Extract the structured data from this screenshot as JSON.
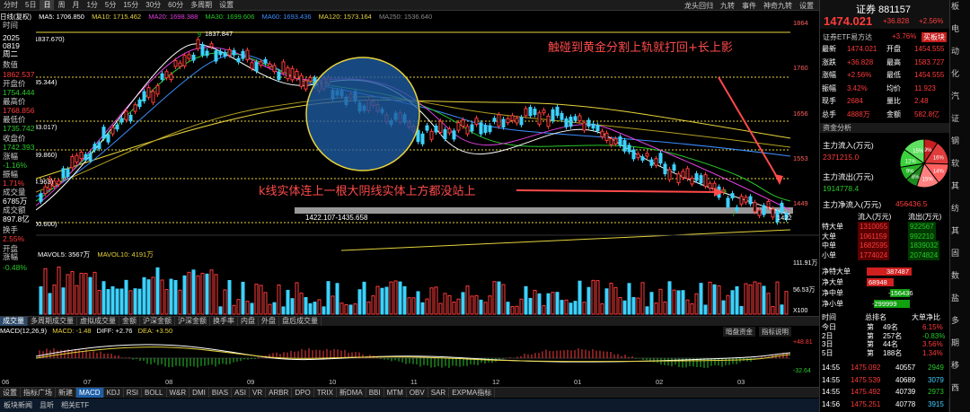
{
  "tabbar": {
    "items": [
      "分时",
      "5日",
      "日",
      "周",
      "月",
      "1分",
      "5分",
      "15分",
      "30分",
      "60分",
      "多周期",
      "设置"
    ],
    "active": 2
  },
  "topright": [
    "龙头回归",
    "九转",
    "事件",
    "神奇九转",
    "设置"
  ],
  "ma": {
    "label": "日线(复权)",
    "ma5": "MA5: 1706.850",
    "ma10": "MA10: 1715.462",
    "ma20": "MA20: 1698.388",
    "ma30": "MA30: 1699.606",
    "ma60": "MA60: 1693.436",
    "ma120": "MA120: 1573.164",
    "ma250": "MA250: 1536.640"
  },
  "left": {
    "time_label": "时间",
    "year": "2025",
    "date": "0819",
    "weekday": "周二",
    "val_label": "数值",
    "v1": "1862.537",
    "open_label": "开盘价",
    "open": "1754.444",
    "high_label": "最高价",
    "high": "1768.856",
    "low_label": "最低价",
    "low": "1735.742",
    "close_label": "收盘价",
    "close": "1742.393",
    "chg_label": "涨幅",
    "chg": "-1.16%",
    "amp_label": "振幅",
    "amp": "1.71%",
    "vol_label": "成交量",
    "vol": "6785万",
    "amt_label": "成交额",
    "amt": "897.8亿",
    "turn_label": "换手",
    "turn": "2.55%",
    "ochg_label": "开盘涨幅",
    "ochg": "-0.48%"
  },
  "chart_labels": {
    "high_mark": "1837.847",
    "left_1837": "1837.670)",
    "left_1835": "35.344)",
    "left_633": "33.017)",
    "left_9860": "39.860)",
    "left_963": "4.963)",
    "left_0500": "00.600)",
    "range_text": "1422.107-1435.658",
    "low_mark": "1422",
    "count_a": "9",
    "count_b": "9",
    "count_c": "7"
  },
  "price_axis": [
    "1864",
    "1760",
    "1656",
    "1553",
    "1449"
  ],
  "vol_axis": [
    "111.91万",
    "56.53万",
    "X100"
  ],
  "macd_axis": [
    "+48.81",
    "-32.64"
  ],
  "annotations": {
    "top": "触碰到黄金分割上轨就打回+长上影",
    "mid": "k线实体连上一根大阴线实体上方都没站上"
  },
  "volbar": {
    "mavol5": "MAVOL5: 3567万",
    "mavol10": "MAVOL10: 4191万"
  },
  "bottomtabs": [
    "成交量",
    "多周期成交量",
    "虚拟成交量",
    "金额",
    "沪深金额",
    "沪深金额",
    "换手率",
    "内盘",
    "外盘",
    "盘后成交量"
  ],
  "macd": {
    "label": "MACD(12,26,9)",
    "macd": "MACD: -1.48",
    "diff": "DIFF: +2.76",
    "dea": "DEA: +3.50",
    "btn1": "暗盘资金",
    "btn2": "指标说明"
  },
  "xaxis": [
    "06",
    "07",
    "08",
    "09",
    "10",
    "11",
    "12",
    "01",
    "02",
    "03",
    "04"
  ],
  "footbar": [
    "设置",
    "指标广场",
    "新建",
    "MACD",
    "KDJ",
    "RSI",
    "BOLL",
    "W&R",
    "DMI",
    "BIAS",
    "ASI",
    "VR",
    "ARBR",
    "DPO",
    "TRIX",
    "新DMA",
    "BBI",
    "MTM",
    "OBV",
    "SAR",
    "EXPMA指标"
  ],
  "footbar_active": 3,
  "statusbar": [
    "板块新闻",
    "且听",
    "相关ETF"
  ],
  "rp": {
    "title": "证券 881157",
    "price": "1474.021",
    "change": "+36.828",
    "pct": "+2.56%",
    "sub1": "证券ETF易方达",
    "sub2": "+3.76%",
    "sub3": "买板块",
    "rows": [
      [
        "最新",
        "1474.021",
        "开盘",
        "1454.555"
      ],
      [
        "涨跌",
        "+36.828",
        "最高",
        "1583.727"
      ],
      [
        "涨幅",
        "+2.56%",
        "最低",
        "1454.555"
      ],
      [
        "振幅",
        "3.42%",
        "均价",
        "11.923"
      ],
      [
        "现手",
        "2684",
        "量比",
        "2.48"
      ],
      [
        "总手",
        "4888万",
        "金额",
        "582.8亿"
      ]
    ],
    "sec1": "资金分析",
    "inflow_label": "主力流入(万元)",
    "inflow": "2371215.0",
    "outflow_label": "主力流出(万元)",
    "outflow": "1914778.4",
    "net_label": "主力净流入(万元)",
    "net": "456436.5",
    "pie": [
      "9%",
      "16%",
      "14%",
      "15%",
      "8%",
      "9%",
      "12%",
      "15%"
    ],
    "flow_head": [
      "",
      "流入(万元)",
      "流出(万元)"
    ],
    "flows": [
      [
        "特大单",
        "1310055",
        "922567"
      ],
      [
        "大单",
        "1061159",
        "992210"
      ],
      [
        "中单",
        "1682595",
        "1839032"
      ],
      [
        "小单",
        "1774024",
        "2074824"
      ]
    ],
    "nets": [
      [
        "净特大单",
        "387487"
      ],
      [
        "净大单",
        "68948"
      ],
      [
        "净中单",
        "-156436"
      ],
      [
        "净小单",
        "-299999"
      ]
    ],
    "rank_head": [
      "时间",
      "总排名",
      "大单净比"
    ],
    "ranks": [
      [
        "今日",
        "第",
        "49名",
        "6.15%"
      ],
      [
        "2日",
        "第",
        "257名",
        "-0.83%"
      ],
      [
        "3日",
        "第",
        "44名",
        "3.56%"
      ],
      [
        "5日",
        "第",
        "188名",
        "1.34%"
      ]
    ],
    "ticks": [
      [
        "14:55",
        "1475.092",
        "40557",
        "2949"
      ],
      [
        "14:55",
        "1475.539",
        "40689",
        "3079"
      ],
      [
        "14:55",
        "1475.492",
        "40739",
        "2973"
      ],
      [
        "14:56",
        "1475.251",
        "40778",
        "3915"
      ]
    ]
  },
  "far": [
    "板",
    "电",
    "动",
    "化",
    "汽",
    "证",
    "钢",
    "软",
    "其",
    "纺",
    "其",
    "固",
    "数",
    "盐",
    "多",
    "期",
    "移",
    "西"
  ]
}
